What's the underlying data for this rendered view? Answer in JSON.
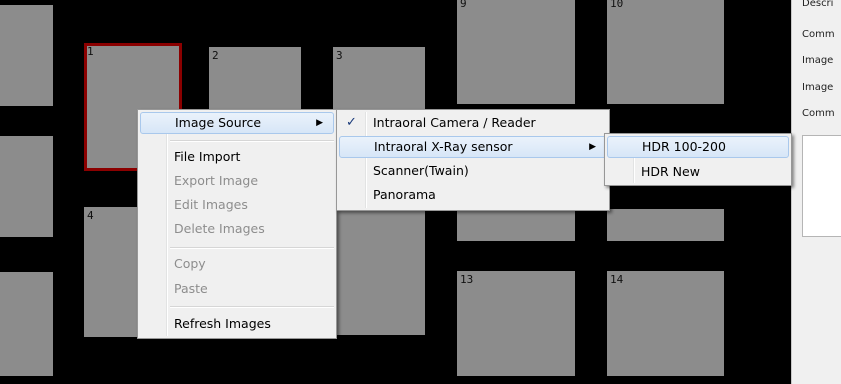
{
  "thumbnails": [
    {
      "num": "1",
      "selected": true
    },
    {
      "num": "2"
    },
    {
      "num": "3"
    },
    {
      "num": "4"
    },
    {
      "num": "9"
    },
    {
      "num": "10"
    },
    {
      "num": "13"
    },
    {
      "num": "14"
    }
  ],
  "right_panel": {
    "labels": [
      "Descri",
      "Comm",
      "Image",
      "Image",
      "Comm"
    ]
  },
  "context_menu": {
    "image_source": "Image Source",
    "file_import": "File Import",
    "export_image": "Export Image",
    "edit_images": "Edit Images",
    "delete_images": "Delete Images",
    "copy": "Copy",
    "paste": "Paste",
    "refresh_images": "Refresh Images"
  },
  "source_menu": {
    "camera_reader": "Intraoral Camera / Reader",
    "xray_sensor": "Intraoral X-Ray sensor",
    "scanner": "Scanner(Twain)",
    "panorama": "Panorama",
    "check_glyph": "✓"
  },
  "sensor_menu": {
    "hdr_100_200": "HDR 100-200",
    "hdr_new": "HDR New"
  },
  "glyphs": {
    "submenu_arrow": "▶"
  }
}
